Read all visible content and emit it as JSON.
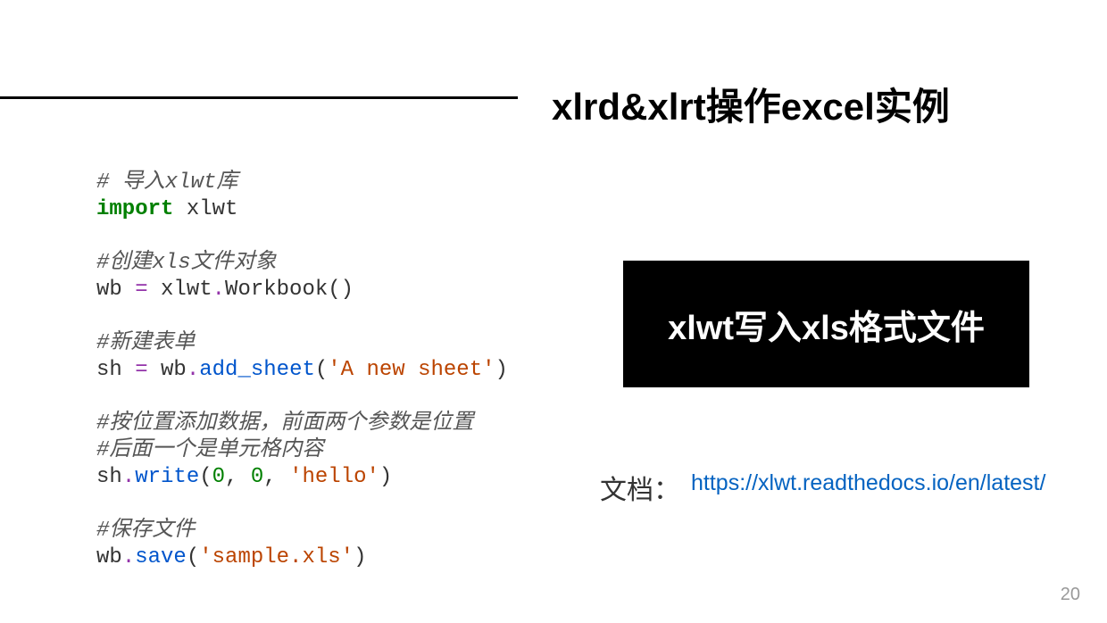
{
  "title": "xlrd&xlrt操作excel实例",
  "code": {
    "line1_comment": "# 导入xlwt库",
    "line2_keyword": "import",
    "line2_text": " xlwt",
    "line4_comment": "#创建xls文件对象",
    "line5_text1": "wb ",
    "line5_op": "=",
    "line5_text2": " xlwt",
    "line5_dot1": ".",
    "line5_text3": "Workbook()",
    "line7_comment": "#新建表单",
    "line8_text1": "sh ",
    "line8_op": "=",
    "line8_text2": " wb",
    "line8_dot": ".",
    "line8_method": "add_sheet",
    "line8_paren1": "(",
    "line8_string": "'A new sheet'",
    "line8_paren2": ")",
    "line10_comment": "#按位置添加数据，前面两个参数是位置",
    "line11_comment": "#后面一个是单元格内容",
    "line12_text1": "sh",
    "line12_dot": ".",
    "line12_method": "write",
    "line12_paren1": "(",
    "line12_num1": "0",
    "line12_comma1": ", ",
    "line12_num2": "0",
    "line12_comma2": ", ",
    "line12_string": "'hello'",
    "line12_paren2": ")",
    "line14_comment": "#保存文件",
    "line15_text1": "wb",
    "line15_dot": ".",
    "line15_method": "save",
    "line15_paren1": "(",
    "line15_string": "'sample.xls'",
    "line15_paren2": ")"
  },
  "black_box": "xlwt写入xls格式文件",
  "doc_label": "文档：",
  "doc_link": "https://xlwt.readthedocs.io/en/latest/",
  "page_number": "20"
}
